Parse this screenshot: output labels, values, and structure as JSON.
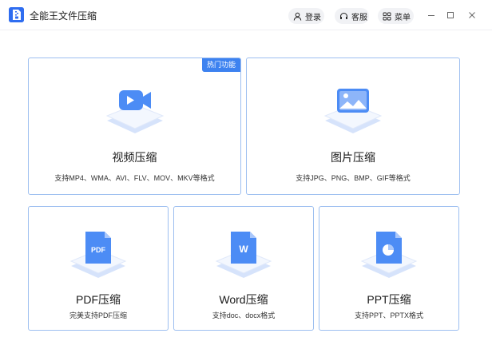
{
  "app": {
    "title": "全能王文件压缩"
  },
  "header": {
    "login_label": "登录",
    "service_label": "客服",
    "menu_label": "菜单"
  },
  "cards": {
    "video": {
      "title": "视频压缩",
      "desc": "支持MP4、WMA、AVI、FLV、MOV、MKV等格式",
      "badge": "热门功能"
    },
    "image": {
      "title": "图片压缩",
      "desc": "支持JPG、PNG、BMP、GIF等格式"
    },
    "pdf": {
      "title": "PDF压缩",
      "desc": "完美支持PDF压缩",
      "icon_text": "PDF"
    },
    "word": {
      "title": "Word压缩",
      "desc": "支持doc、docx格式",
      "icon_text": "W"
    },
    "ppt": {
      "title": "PPT压缩",
      "desc": "支持PPT、PPTX格式"
    }
  },
  "colors": {
    "accent": "#3d82f0",
    "card_border": "#9dbff0",
    "icon_blue": "#4c8cf5"
  }
}
